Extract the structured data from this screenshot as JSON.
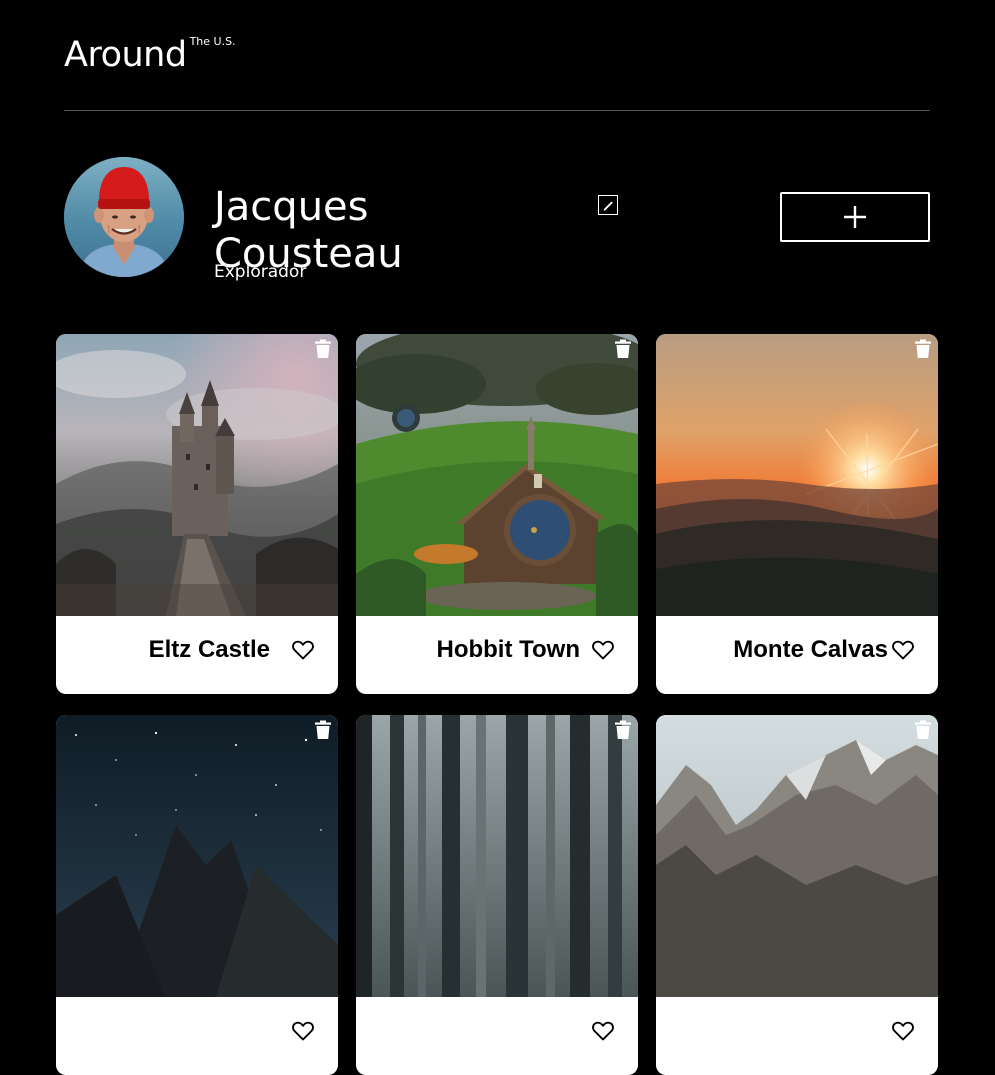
{
  "header": {
    "logo_main": "Around",
    "logo_sup": "The U.S."
  },
  "profile": {
    "name": "Jacques Cousteau",
    "job": "Explorador"
  },
  "cards": [
    {
      "title": "Eltz Castle",
      "liked": false
    },
    {
      "title": "Hobbit Town",
      "liked": false
    },
    {
      "title": "Monte Calvas",
      "liked": false
    },
    {
      "title": "",
      "liked": false
    },
    {
      "title": "",
      "liked": false
    },
    {
      "title": "",
      "liked": false
    }
  ],
  "icons": {
    "edit": "pencil-icon",
    "add": "plus-icon",
    "delete": "trash-icon",
    "like": "heart-outline-icon"
  },
  "colors": {
    "background": "#000000",
    "text": "#ffffff",
    "card": "#ffffff",
    "divider": "#545454"
  }
}
